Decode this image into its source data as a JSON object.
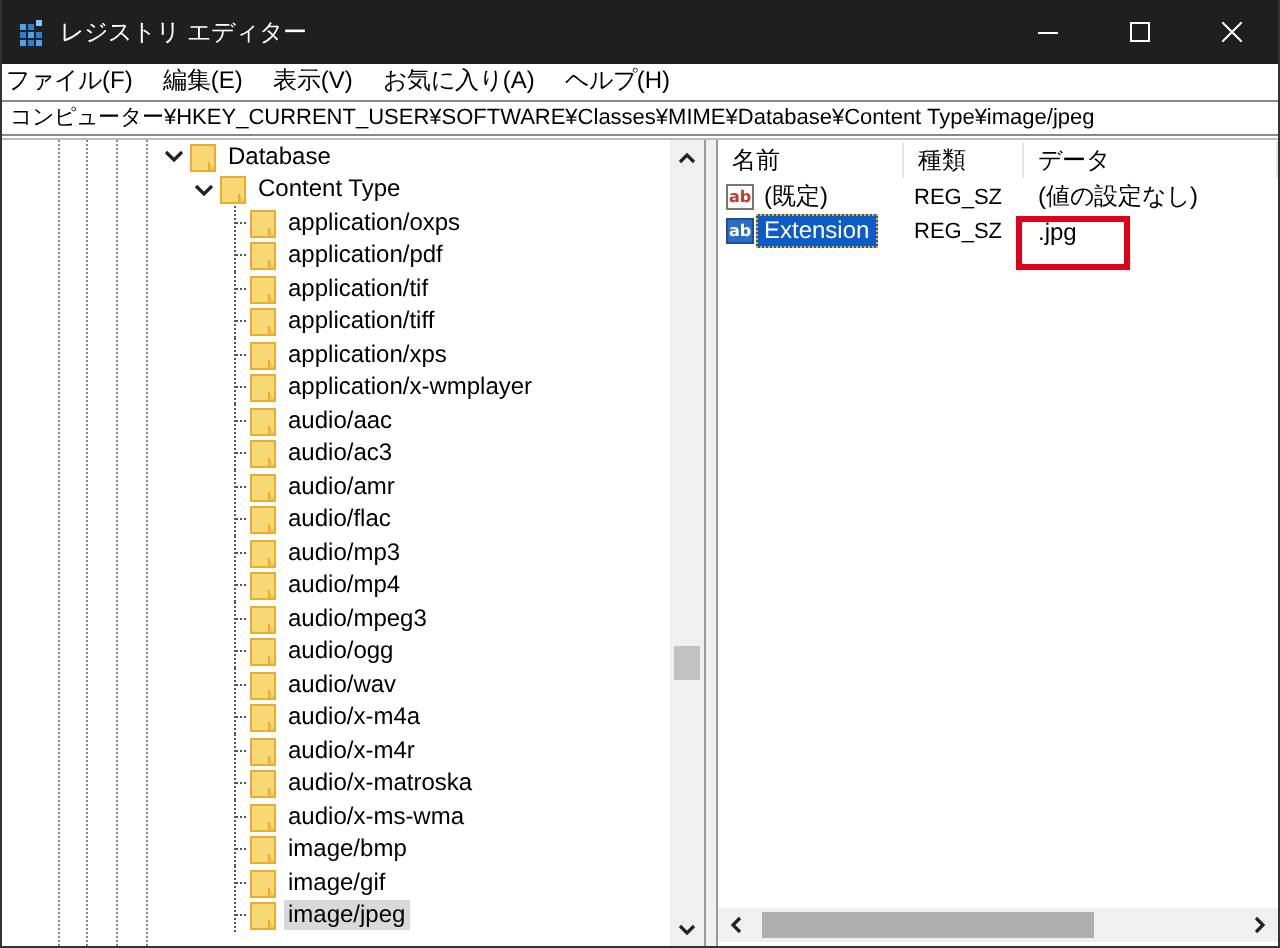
{
  "window": {
    "title": "レジストリ エディター"
  },
  "menu": [
    {
      "label": "ファイル(F)"
    },
    {
      "label": "編集(E)"
    },
    {
      "label": "表示(V)"
    },
    {
      "label": "お気に入り(A)"
    },
    {
      "label": "ヘルプ(H)"
    }
  ],
  "address": "コンピューター¥HKEY_CURRENT_USER¥SOFTWARE¥Classes¥MIME¥Database¥Content Type¥image/jpeg",
  "tree": {
    "items": [
      {
        "label": "Database",
        "expanded": true,
        "selected": false,
        "children": [
          {
            "label": "Content Type",
            "expanded": true,
            "selected": false,
            "children": [
              {
                "label": "application/oxps",
                "selected": false
              },
              {
                "label": "application/pdf",
                "selected": false
              },
              {
                "label": "application/tif",
                "selected": false
              },
              {
                "label": "application/tiff",
                "selected": false
              },
              {
                "label": "application/xps",
                "selected": false
              },
              {
                "label": "application/x-wmplayer",
                "selected": false
              },
              {
                "label": "audio/aac",
                "selected": false
              },
              {
                "label": "audio/ac3",
                "selected": false
              },
              {
                "label": "audio/amr",
                "selected": false
              },
              {
                "label": "audio/flac",
                "selected": false
              },
              {
                "label": "audio/mp3",
                "selected": false
              },
              {
                "label": "audio/mp4",
                "selected": false
              },
              {
                "label": "audio/mpeg3",
                "selected": false
              },
              {
                "label": "audio/ogg",
                "selected": false
              },
              {
                "label": "audio/wav",
                "selected": false
              },
              {
                "label": "audio/x-m4a",
                "selected": false
              },
              {
                "label": "audio/x-m4r",
                "selected": false
              },
              {
                "label": "audio/x-matroska",
                "selected": false
              },
              {
                "label": "audio/x-ms-wma",
                "selected": false
              },
              {
                "label": "image/bmp",
                "selected": false
              },
              {
                "label": "image/gif",
                "selected": false
              },
              {
                "label": "image/jpeg",
                "selected": true
              }
            ]
          }
        ]
      }
    ]
  },
  "values": {
    "columns": [
      "名前",
      "種類",
      "データ"
    ],
    "rows": [
      {
        "kind": "string",
        "icon_label": "ab",
        "name": "(既定)",
        "type": "REG_SZ",
        "data": "(値の設定なし)",
        "selected": false,
        "highlighted": false
      },
      {
        "kind": "string",
        "icon_label": "ab",
        "name": "Extension",
        "type": "REG_SZ",
        "data": ".jpg",
        "selected": true,
        "highlighted": true
      }
    ]
  }
}
